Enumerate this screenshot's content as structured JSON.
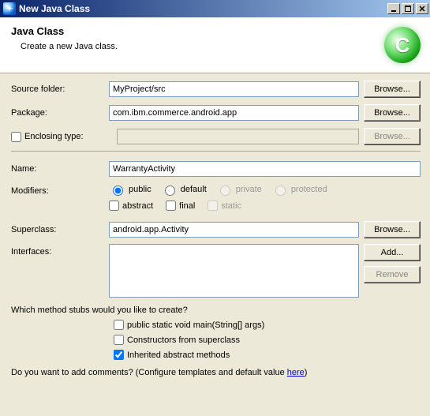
{
  "window": {
    "title": "New Java Class"
  },
  "banner": {
    "heading": "Java Class",
    "sub": "Create a new Java class.",
    "icon_letter": "C"
  },
  "labels": {
    "source_folder": "Source folder:",
    "package": "Package:",
    "enclosing": "Enclosing type:",
    "name": "Name:",
    "modifiers": "Modifiers:",
    "superclass": "Superclass:",
    "interfaces": "Interfaces:"
  },
  "values": {
    "source_folder": "MyProject/src",
    "package": "com.ibm.commerce.android.app",
    "enclosing": "",
    "name": "WarrantyActivity",
    "superclass": "android.app.Activity"
  },
  "buttons": {
    "browse": "Browse...",
    "add": "Add...",
    "remove": "Remove"
  },
  "modifiers": {
    "public": "public",
    "default": "default",
    "private": "private",
    "protected": "protected",
    "abstract": "abstract",
    "final": "final",
    "static": "static"
  },
  "questions": {
    "stubs": "Which method stubs would you like to create?",
    "main": "public static void main(String[] args)",
    "constructors": "Constructors from superclass",
    "inherited": "Inherited abstract methods",
    "comments_prefix": "Do you want to add comments? (Configure templates and default value ",
    "comments_link": "here",
    "comments_suffix": ")"
  }
}
